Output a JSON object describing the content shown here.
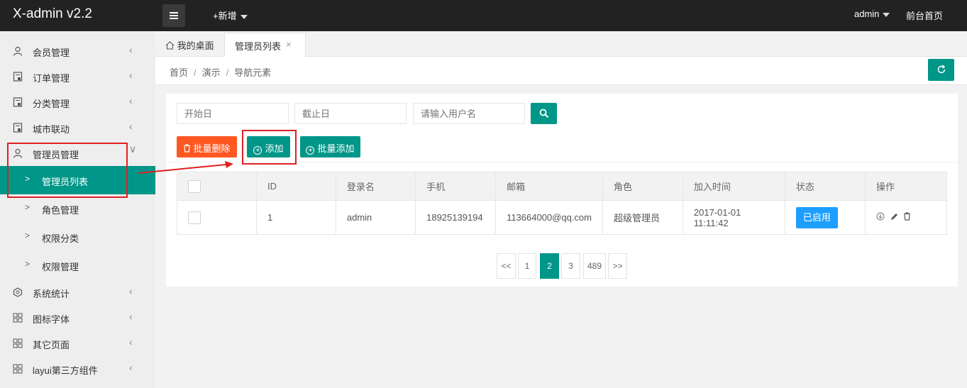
{
  "app": {
    "title": "X-admin v2.2"
  },
  "header": {
    "add_new": "+新增",
    "user": "admin",
    "front_page": "前台首页"
  },
  "sidebar": {
    "items": [
      {
        "label": "会员管理",
        "icon": "user-icon"
      },
      {
        "label": "订单管理",
        "icon": "order-icon"
      },
      {
        "label": "分类管理",
        "icon": "category-icon"
      },
      {
        "label": "城市联动",
        "icon": "city-icon"
      },
      {
        "label": "管理员管理",
        "icon": "admin-icon",
        "expanded": true
      },
      {
        "label": "系统统计",
        "icon": "stats-icon"
      },
      {
        "label": "图标字体",
        "icon": "grid-icon"
      },
      {
        "label": "其它页面",
        "icon": "grid-icon"
      },
      {
        "label": "layui第三方组件",
        "icon": "grid-icon"
      }
    ],
    "sub_items": [
      {
        "label": "管理员列表",
        "active": true
      },
      {
        "label": "角色管理"
      },
      {
        "label": "权限分类"
      },
      {
        "label": "权限管理"
      }
    ]
  },
  "tabs": {
    "home": "我的桌面",
    "active": "管理员列表",
    "close": "×"
  },
  "breadcrumb": {
    "items": [
      "首页",
      "演示",
      "导航元素"
    ]
  },
  "filters": {
    "start_placeholder": "开始日",
    "end_placeholder": "截止日",
    "user_placeholder": "请输入用户名"
  },
  "toolbar": {
    "batch_delete": "批量删除",
    "add": "添加",
    "batch_add": "批量添加"
  },
  "table": {
    "columns": [
      "ID",
      "登录名",
      "手机",
      "邮箱",
      "角色",
      "加入时间",
      "状态",
      "操作"
    ],
    "rows": [
      {
        "id": "1",
        "login": "admin",
        "phone": "18925139194",
        "email": "113664000@qq.com",
        "role": "超级管理员",
        "joined": "2017-01-01 11:11:42",
        "status": "已启用"
      }
    ]
  },
  "pagination": {
    "prev": "<<",
    "pages": [
      "1",
      "2",
      "3",
      "489"
    ],
    "current": "2",
    "next": ">>"
  },
  "colors": {
    "primary": "#009688",
    "danger": "#ff5722",
    "info": "#1e9fff",
    "topbar": "#222222",
    "annotation": "#e02020"
  }
}
